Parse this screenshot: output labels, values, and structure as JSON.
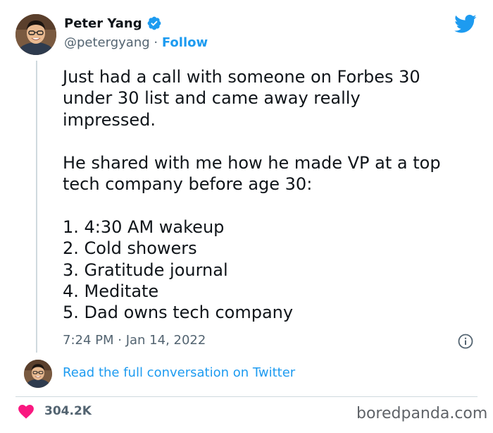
{
  "author": {
    "display_name": "Peter Yang",
    "handle": "@petergyang",
    "separator": " · ",
    "follow_label": "Follow",
    "verified_icon": "verified-badge-icon"
  },
  "tweet": {
    "paragraphs": [
      [
        "Just had a call with someone on Forbes 30",
        "under 30 list and came away really",
        "impressed."
      ],
      [
        "He shared with me how he made VP at a top",
        "tech company before age 30:"
      ],
      [
        "1. 4:30 AM wakeup",
        "2. Cold showers",
        "3. Gratitude journal",
        "4. Meditate",
        "5. Dad owns tech company"
      ]
    ],
    "timestamp": "7:24 PM · Jan 14, 2022"
  },
  "conversation": {
    "read_full_label": "Read the full conversation on Twitter"
  },
  "engagement": {
    "likes": "304.2K",
    "like_icon": "heart-icon"
  },
  "watermark": "boredpanda.com",
  "colors": {
    "twitter_blue": "#1d9bf0",
    "heart_red": "#f91880",
    "text_primary": "#0f1419",
    "text_secondary": "#536471",
    "divider": "#cfd9de"
  }
}
